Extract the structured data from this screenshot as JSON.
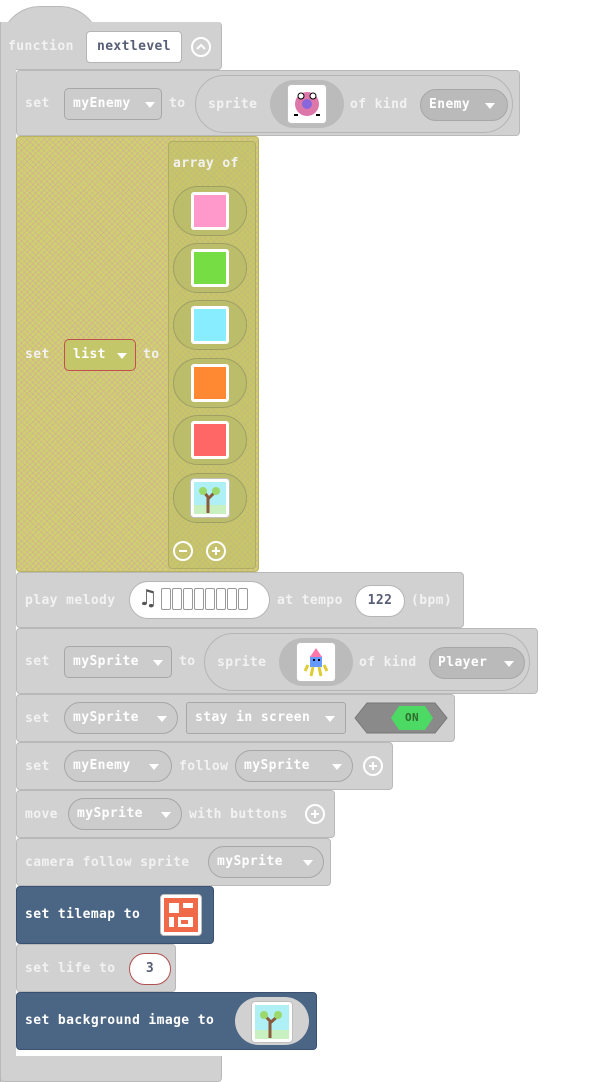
{
  "function_block": {
    "keyword": "function",
    "name": "nextlevel",
    "collapse_icon": "chevron-up-icon"
  },
  "blocks": {
    "set_enemy": {
      "set": "set",
      "variable": "myEnemy",
      "to": "to",
      "sprite": "sprite",
      "of_kind": "of kind",
      "kind": "Enemy"
    },
    "set_list": {
      "set": "set",
      "variable": "list",
      "to": "to",
      "array_of": "array of",
      "items": [
        "#ff99cc",
        "#77dd44",
        "#88eeff",
        "#ff8833",
        "#ff6666",
        "tree-image"
      ]
    },
    "play_melody": {
      "play": "play melody",
      "at_tempo": "at tempo",
      "tempo": "122",
      "bpm": "(bpm)",
      "melody_icon": "music-note-icon"
    },
    "set_sprite": {
      "set": "set",
      "variable": "mySprite",
      "to": "to",
      "sprite": "sprite",
      "of_kind": "of kind",
      "kind": "Player"
    },
    "stay_in_screen": {
      "set": "set",
      "variable": "mySprite",
      "property": "stay in screen",
      "toggle": "ON"
    },
    "follow": {
      "set": "set",
      "variable": "myEnemy",
      "follow": "follow",
      "target": "mySprite"
    },
    "move": {
      "move": "move",
      "variable": "mySprite",
      "with_buttons": "with buttons"
    },
    "camera": {
      "label": "camera follow sprite",
      "variable": "mySprite"
    },
    "tilemap": {
      "label": "set tilemap to"
    },
    "life": {
      "label": "set life to",
      "value": "3"
    },
    "background": {
      "label": "set background image to"
    }
  },
  "colors": {
    "block": "#d1d1d1",
    "array_block": "#cfd16f",
    "scene_block": "#4b6584",
    "toggle_on": "#4cd964"
  }
}
